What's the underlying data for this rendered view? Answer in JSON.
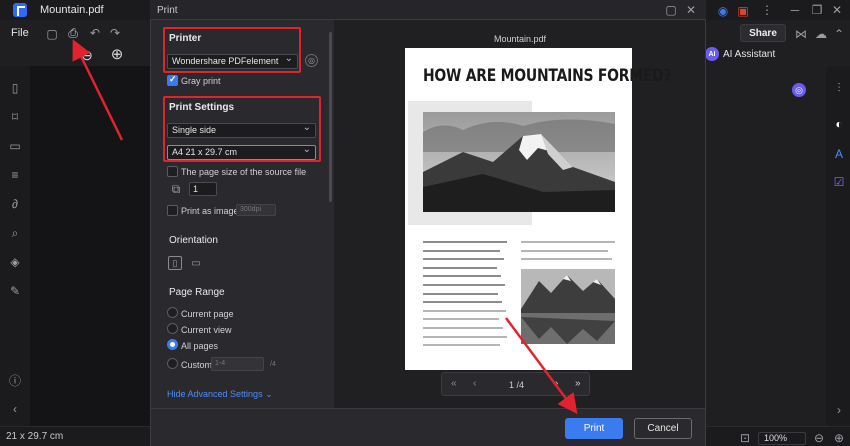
{
  "app": {
    "title": "Mountain.pdf",
    "menu_file": "File",
    "share": "Share",
    "ai_badge": "AI",
    "ai_assistant": "AI Assistant",
    "status_size": "21 x 29.7 cm",
    "zoom": "100%"
  },
  "dialog": {
    "title": "Print",
    "printer": {
      "section": "Printer",
      "selected": "Wondershare PDFelement",
      "gray_print": "Gray print"
    },
    "print_settings": {
      "section": "Print Settings",
      "sides": "Single side",
      "paper": "A4 21 x 29.7 cm",
      "page_size_source": "The page size of the source file",
      "copies": "1",
      "print_as_image": "Print as image",
      "dpi": "300dpi"
    },
    "orientation": {
      "section": "Orientation"
    },
    "page_range": {
      "section": "Page Range",
      "options": [
        "Current page",
        "Current view",
        "All pages",
        "Custom"
      ],
      "selected": "All pages",
      "custom_placeholder": "1-4",
      "custom_total": "/4"
    },
    "hide_advanced": "Hide Advanced Settings",
    "buttons": {
      "print": "Print",
      "cancel": "Cancel"
    }
  },
  "preview": {
    "file_name": "Mountain.pdf",
    "page_indicator": "1 /4",
    "heading": "HOW ARE MOUNTAINS FORMED?"
  },
  "colors": {
    "accent": "#3a7cf0",
    "annotation_red": "#e0232e"
  }
}
